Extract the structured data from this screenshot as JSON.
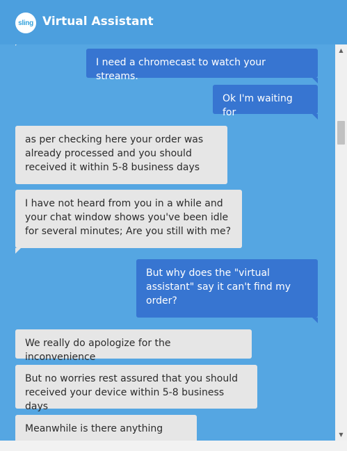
{
  "header": {
    "logo_text": "sling",
    "title": "Virtual Assistant"
  },
  "messages": [
    {
      "from": "user",
      "text": "I need a chromecast to watch your streams."
    },
    {
      "from": "user",
      "text": "Ok I'm waiting for"
    },
    {
      "from": "bot",
      "lines": [
        "as per checking here your order was",
        "already processed and you should",
        "received it within 5-8 business days"
      ]
    },
    {
      "from": "bot",
      "lines": [
        "I have not heard from you in a while and",
        "your chat window shows you've been idle",
        "for several minutes; Are you still with me?"
      ]
    },
    {
      "from": "user",
      "lines": [
        "But why does the \"virtual",
        "assistant\" say it can't find my",
        "order?"
      ]
    },
    {
      "from": "bot",
      "text": "We really do apologize for the inconvenience"
    },
    {
      "from": "bot",
      "lines": [
        "But no worries rest assured that you should",
        "received your device within 5-8 business days"
      ]
    },
    {
      "from": "bot",
      "text": "Meanwhile is there anything"
    }
  ],
  "colors": {
    "background": "#55a6e2",
    "user_bubble": "#3775d1",
    "bot_bubble": "#e6e6e6"
  }
}
